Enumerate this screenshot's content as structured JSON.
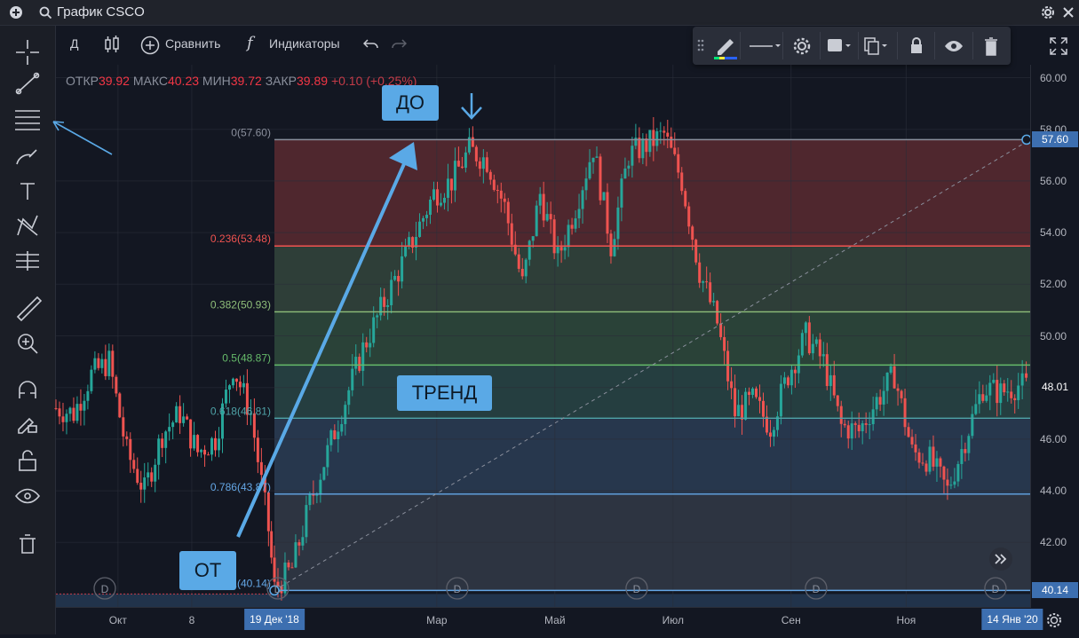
{
  "window": {
    "title": "График CSCO"
  },
  "toolbar": {
    "interval": "Д",
    "compare": "Сравнить",
    "indicators": "Индикаторы"
  },
  "ohlc": {
    "open_label": "ОТКР",
    "open": "39.92",
    "high_label": "МАКС",
    "high": "40.23",
    "low_label": "МИН",
    "low": "39.72",
    "close_label": "ЗАКР",
    "close": "39.89",
    "change": "+0.10 (+0.25%)"
  },
  "callouts": {
    "to": "ДО",
    "trend": "ТРЕНД",
    "from": "ОТ"
  },
  "colors": {
    "up": "#26a69a",
    "down": "#ef5350",
    "accent": "#5aa9e6",
    "bg": "#131722"
  },
  "chart_data": {
    "type": "line",
    "title": "",
    "y_ticks": [
      "60.00",
      "58.00",
      "56.00",
      "54.00",
      "52.00",
      "50.00",
      "48.00",
      "46.00",
      "44.00",
      "42.00"
    ],
    "ylim": [
      39.5,
      60.5
    ],
    "x_ticks": [
      {
        "label": "Окт",
        "month_index": 0.15
      },
      {
        "label": "8",
        "month_index": 1.4
      },
      {
        "label": "Мар",
        "month_index": 5.55
      },
      {
        "label": "Май",
        "month_index": 7.55
      },
      {
        "label": "Июл",
        "month_index": 9.55
      },
      {
        "label": "Сен",
        "month_index": 11.55
      },
      {
        "label": "Ноя",
        "month_index": 13.5
      }
    ],
    "x_range": [
      -0.9,
      15.6
    ],
    "crosshair_dates": {
      "start": "19 Дек '18",
      "end": "14 Янв '20"
    },
    "fibonacci": {
      "from": {
        "month_index": 2.8,
        "price": 40.14
      },
      "to": {
        "month_index": 15.6,
        "price": 57.6
      },
      "levels": [
        {
          "ratio": "0",
          "price": 57.6,
          "label": "0(57.60)",
          "color": "#8a8f9c",
          "fill": "#5b2a30"
        },
        {
          "ratio": "0.236",
          "price": 53.48,
          "label": "0.236(53.48)",
          "color": "#ef5350",
          "fill": "#34453c"
        },
        {
          "ratio": "0.382",
          "price": 50.93,
          "label": "0.382(50.93)",
          "color": "#8fbf7a",
          "fill": "#2f4a3c"
        },
        {
          "ratio": "0.5",
          "price": 48.87,
          "label": "0.5(48.87)",
          "color": "#66bb6a",
          "fill": "#294545"
        },
        {
          "ratio": "0.618",
          "price": 46.81,
          "label": "0.618(46.81)",
          "color": "#4fa3a8",
          "fill": "#2b3d55"
        },
        {
          "ratio": "0.786",
          "price": 43.87,
          "label": "0.786(43.87)",
          "color": "#64a7e6",
          "fill": "#333a47"
        },
        {
          "ratio": "1",
          "price": 40.14,
          "label": "1(40.14)",
          "color": "#64a7e6",
          "fill": "#283c58"
        }
      ]
    },
    "series": [
      {
        "name": "",
        "x": [
          -0.9,
          -0.6,
          -0.3,
          0.0,
          0.3,
          0.6,
          0.9,
          1.2,
          1.5,
          1.8,
          2.1,
          2.4,
          2.7,
          2.8,
          3.1,
          3.4,
          3.7,
          4.0,
          4.3,
          4.6,
          4.9,
          5.2,
          5.5,
          5.8,
          6.1,
          6.4,
          6.7,
          7.0,
          7.3,
          7.6,
          7.9,
          8.2,
          8.5,
          8.8,
          9.1,
          9.4,
          9.7,
          10.0,
          10.3,
          10.6,
          10.9,
          11.2,
          11.5,
          11.8,
          12.1,
          12.4,
          12.7,
          13.0,
          13.3,
          13.6,
          13.9,
          14.2,
          14.5,
          14.8,
          15.1,
          15.4,
          15.6
        ],
        "values": [
          47.2,
          47.0,
          48.5,
          49.0,
          45.5,
          44.0,
          46.2,
          47.0,
          45.5,
          46.0,
          48.8,
          47.0,
          42.5,
          40.2,
          41.0,
          43.5,
          45.5,
          47.5,
          49.5,
          51.0,
          52.5,
          54.0,
          55.5,
          56.0,
          57.2,
          56.8,
          55.0,
          52.0,
          55.5,
          53.0,
          55.0,
          57.3,
          53.5,
          57.0,
          57.4,
          57.8,
          56.0,
          52.5,
          50.5,
          47.0,
          47.5,
          46.5,
          48.5,
          50.0,
          49.0,
          46.5,
          46.3,
          47.5,
          48.5,
          45.5,
          45.2,
          44.0,
          46.0,
          48.0,
          47.8,
          48.1,
          48.01
        ]
      }
    ]
  }
}
